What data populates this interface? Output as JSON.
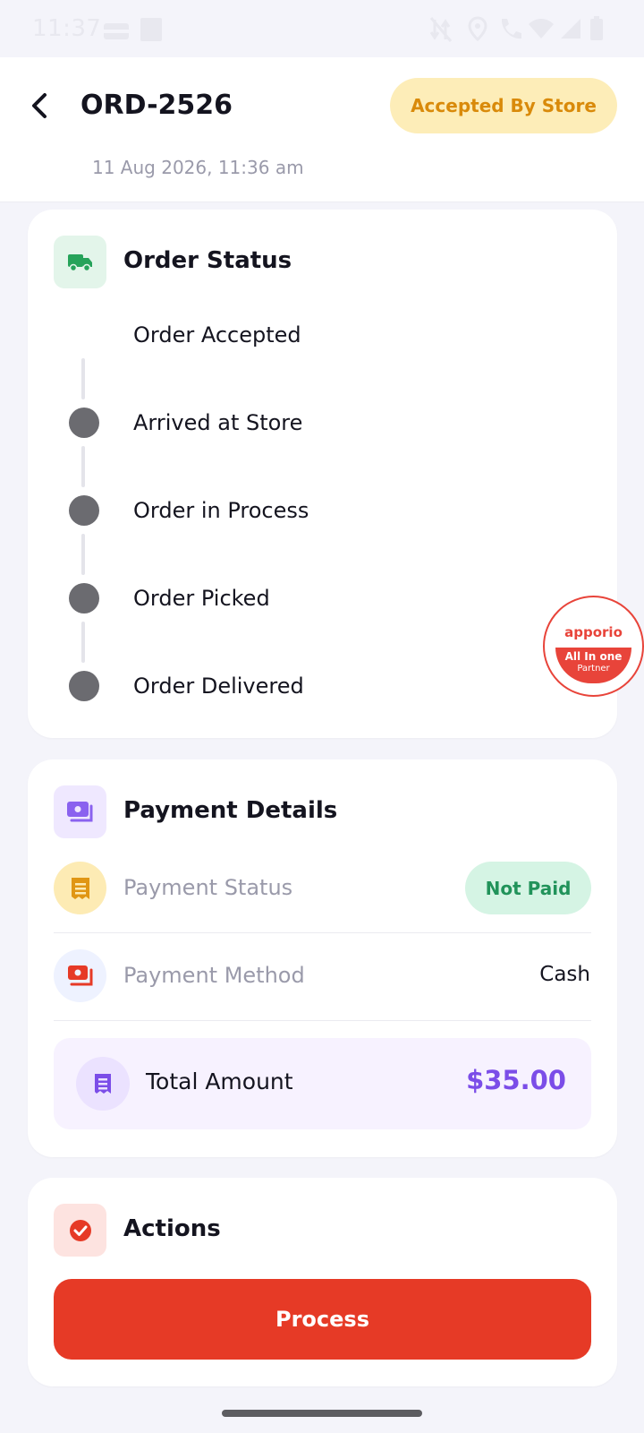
{
  "status_bar": {
    "time": "11:37",
    "icons": [
      "sim-icon",
      "notification-icon",
      "data-off-icon",
      "location-icon",
      "wifi-calling-icon",
      "wifi-icon",
      "signal-icon",
      "battery-icon"
    ]
  },
  "header": {
    "order_id": "ORD-2526",
    "date": "11 Aug 2026, 11:36 am",
    "status": "Accepted By Store",
    "status_color": "#d98a0a"
  },
  "order_status": {
    "title": "Order Status",
    "steps": [
      {
        "label": "Order Accepted",
        "done": true
      },
      {
        "label": "Arrived at Store",
        "done": false
      },
      {
        "label": "Order in Process",
        "done": false
      },
      {
        "label": "Order Picked",
        "done": false
      },
      {
        "label": "Order Delivered",
        "done": false
      }
    ]
  },
  "payment": {
    "title": "Payment Details",
    "status_label": "Payment Status",
    "status_value": "Not Paid",
    "method_label": "Payment Method",
    "method_value": "Cash",
    "total_label": "Total Amount",
    "total_value": "$35.00",
    "accent": "#7b4de8"
  },
  "actions": {
    "title": "Actions",
    "process_label": "Process",
    "button_color": "#e63a26"
  },
  "badge": {
    "brand": "apporio",
    "line1": "All In one",
    "line2": "Partner"
  }
}
